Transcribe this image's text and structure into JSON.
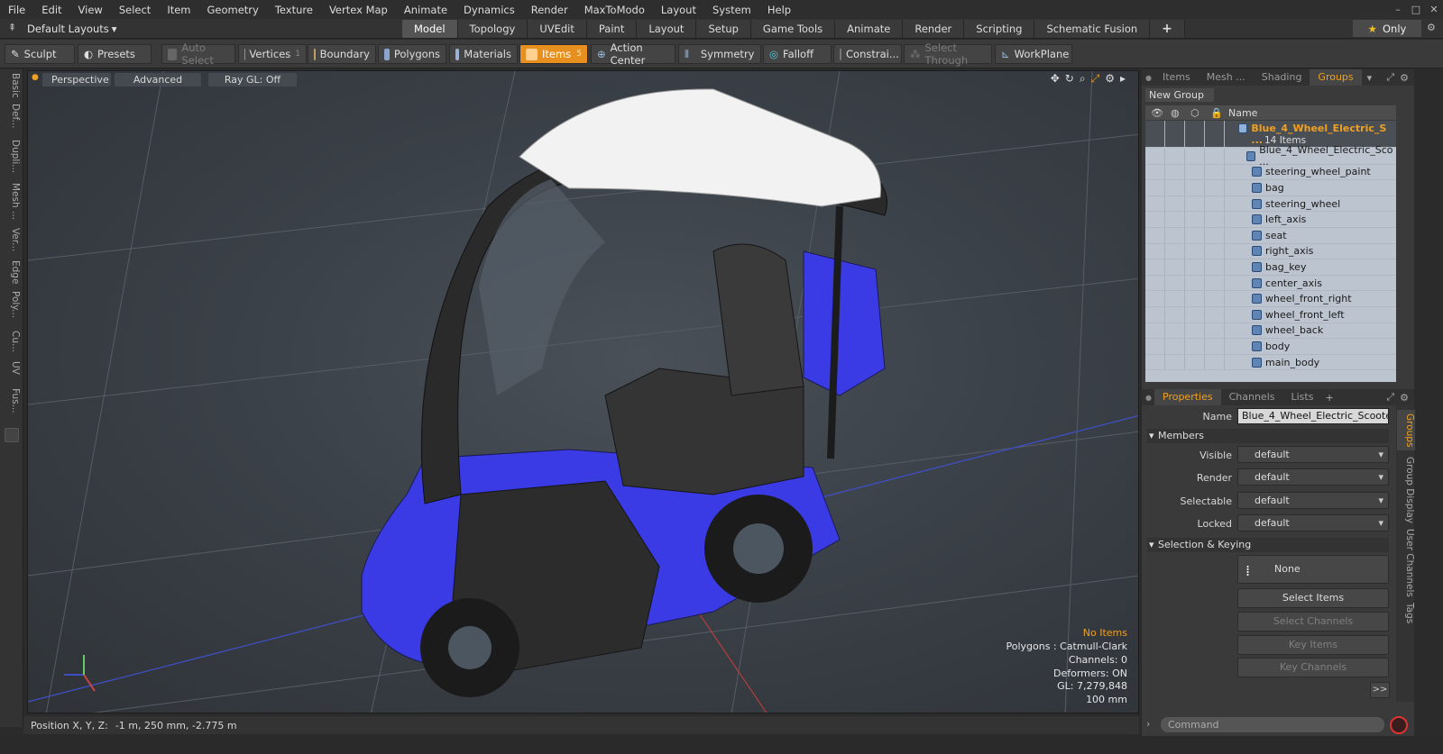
{
  "menu": [
    "File",
    "Edit",
    "View",
    "Select",
    "Item",
    "Geometry",
    "Texture",
    "Vertex Map",
    "Animate",
    "Dynamics",
    "Render",
    "MaxToModo",
    "Layout",
    "System",
    "Help"
  ],
  "layout_select": "Default Layouts",
  "tabs": [
    {
      "label": "Model",
      "active": true
    },
    {
      "label": "Topology"
    },
    {
      "label": "UVEdit"
    },
    {
      "label": "Paint"
    },
    {
      "label": "Layout"
    },
    {
      "label": "Setup"
    },
    {
      "label": "Game Tools"
    },
    {
      "label": "Animate"
    },
    {
      "label": "Render"
    },
    {
      "label": "Scripting"
    },
    {
      "label": "Schematic Fusion"
    }
  ],
  "only_label": "Only",
  "toolbar": {
    "sculpt": "Sculpt",
    "presets": "Presets",
    "auto_select": "Auto Select",
    "vertices": "Vertices",
    "vertices_count": "1",
    "boundary": "Boundary",
    "polygons": "Polygons",
    "materials": "Materials",
    "items": "Items",
    "items_count": "5",
    "action_center": "Action Center",
    "symmetry": "Symmetry",
    "falloff": "Falloff",
    "constraints": "Constrai...",
    "select_through": "Select Through",
    "workplane": "WorkPlane"
  },
  "left_tabs": [
    "Basic",
    "Def...",
    "Dupli...",
    "Mesh ...",
    "Ver...",
    "Edge",
    "Poly...",
    "Cu...",
    "UV",
    "Fus..."
  ],
  "viewport": {
    "perspective": "Perspective",
    "advanced": "Advanced",
    "raygl": "Ray GL: Off",
    "info": [
      "No Items",
      "Polygons : Catmull-Clark",
      "Channels: 0",
      "Deformers: ON",
      "GL: 7,279,848",
      "100 mm"
    ]
  },
  "status": {
    "label": "Position X, Y, Z:",
    "value": "-1 m, 250 mm, -2.775 m"
  },
  "rp_tabs": [
    {
      "label": "Items"
    },
    {
      "label": "Mesh ..."
    },
    {
      "label": "Shading"
    },
    {
      "label": "Groups",
      "active": true
    }
  ],
  "new_group": "New Group",
  "list_header": "Name",
  "group": {
    "name": "Blue_4_Wheel_Electric_S ...",
    "count": "14 Items"
  },
  "items": [
    "Blue_4_Wheel_Electric_Sco ...",
    "steering_wheel_paint",
    "bag",
    "steering_wheel",
    "left_axis",
    "seat",
    "right_axis",
    "bag_key",
    "center_axis",
    "wheel_front_right",
    "wheel_front_left",
    "wheel_back",
    "body",
    "main_body"
  ],
  "props_tabs": [
    {
      "label": "Properties",
      "active": true
    },
    {
      "label": "Channels"
    },
    {
      "label": "Lists"
    }
  ],
  "props": {
    "name_label": "Name",
    "name_value": "Blue_4_Wheel_Electric_Scooter (",
    "members": "Members",
    "visible_label": "Visible",
    "visible": "default",
    "render_label": "Render",
    "render": "default",
    "selectable_label": "Selectable",
    "selectable": "default",
    "locked_label": "Locked",
    "locked": "default",
    "sel_keying": "Selection & Keying",
    "none": "None",
    "select_items": "Select Items",
    "select_channels": "Select Channels",
    "key_items": "Key Items",
    "key_channels": "Key Channels",
    "more": ">>"
  },
  "side_vtabs": [
    "Groups",
    "Group Display",
    "User Channels",
    "Tags"
  ],
  "command_placeholder": "Command",
  "colors": {
    "accent": "#f0a020",
    "scooter_blue": "#3b3be6"
  }
}
